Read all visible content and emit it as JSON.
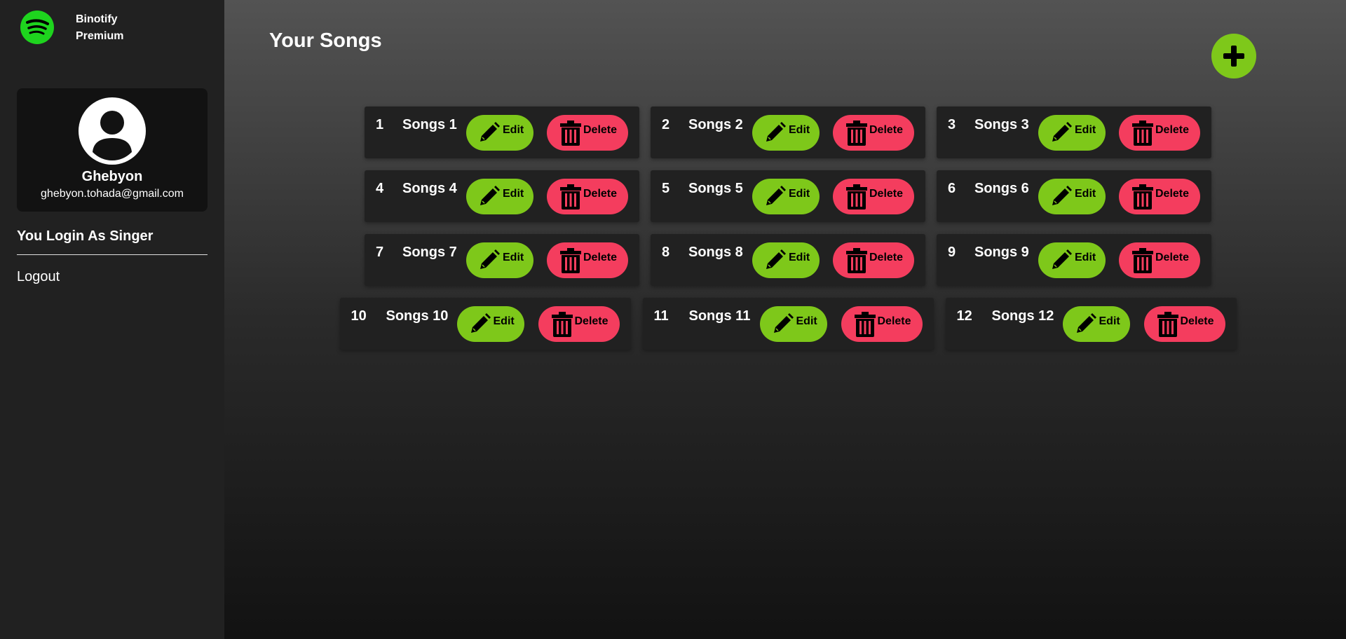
{
  "brand": {
    "line1": "Binotify",
    "line2": "Premium",
    "logo_icon": "spotify-logo-icon",
    "logo_color": "#1ed41e"
  },
  "profile": {
    "avatar_icon": "user-avatar-icon",
    "name": "Ghebyon",
    "email": "ghebyon.tohada@gmail.com"
  },
  "sidebar": {
    "login_role": "You Login As Singer",
    "logout_label": "Logout"
  },
  "main": {
    "title": "Your Songs",
    "add_icon": "plus-icon"
  },
  "songs": [
    {
      "num": "1",
      "title": "Songs 1",
      "edit": "Edit",
      "delete": "Delete"
    },
    {
      "num": "2",
      "title": "Songs 2",
      "edit": "Edit",
      "delete": "Delete"
    },
    {
      "num": "3",
      "title": "Songs 3",
      "edit": "Edit",
      "delete": "Delete"
    },
    {
      "num": "4",
      "title": "Songs 4",
      "edit": "Edit",
      "delete": "Delete"
    },
    {
      "num": "5",
      "title": "Songs 5",
      "edit": "Edit",
      "delete": "Delete"
    },
    {
      "num": "6",
      "title": "Songs 6",
      "edit": "Edit",
      "delete": "Delete"
    },
    {
      "num": "7",
      "title": "Songs 7",
      "edit": "Edit",
      "delete": "Delete"
    },
    {
      "num": "8",
      "title": "Songs 8",
      "edit": "Edit",
      "delete": "Delete"
    },
    {
      "num": "9",
      "title": "Songs 9",
      "edit": "Edit",
      "delete": "Delete"
    },
    {
      "num": "10",
      "title": "Songs 10",
      "edit": "Edit",
      "delete": "Delete"
    },
    {
      "num": "11",
      "title": "Songs 11",
      "edit": "Edit",
      "delete": "Delete"
    },
    {
      "num": "12",
      "title": "Songs 12",
      "edit": "Edit",
      "delete": "Delete"
    }
  ],
  "colors": {
    "edit": "#7ec81a",
    "delete": "#f43d5e",
    "add": "#7ec81a"
  }
}
